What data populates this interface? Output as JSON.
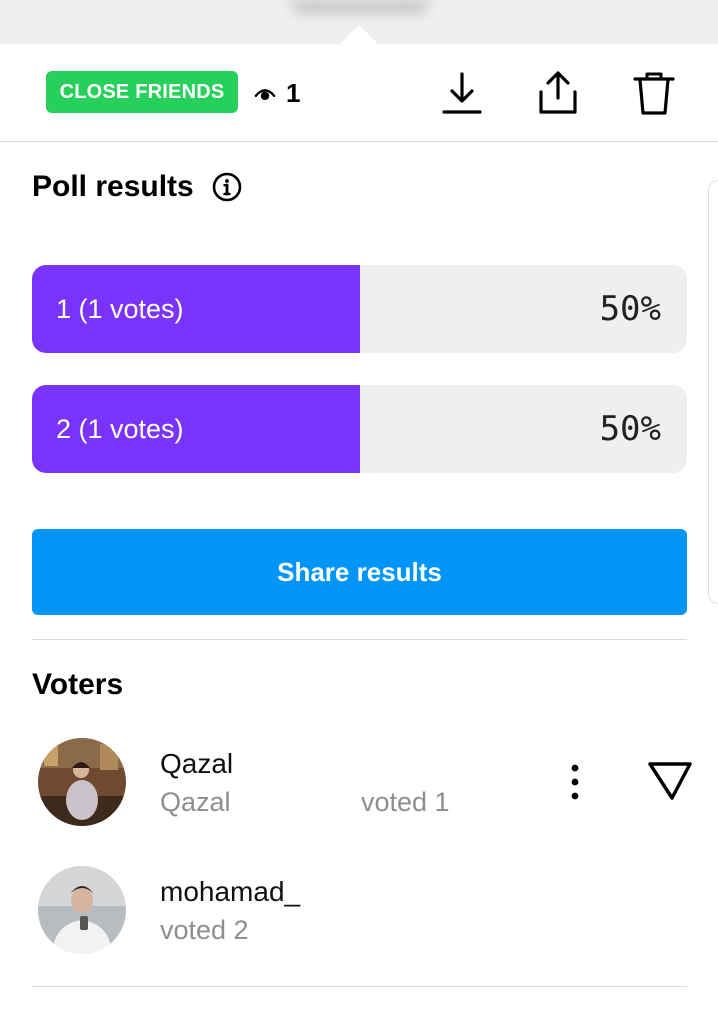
{
  "header": {
    "badge_label": "CLOSE FRIENDS",
    "view_count": "1",
    "icons": [
      "eye-icon",
      "download-icon",
      "share-icon",
      "trash-icon"
    ]
  },
  "poll": {
    "title": "Poll results",
    "options": [
      {
        "label": "1 (1 votes)",
        "percent_text": "50%",
        "fraction": 0.5
      },
      {
        "label": "2 (1 votes)",
        "percent_text": "50%",
        "fraction": 0.5
      }
    ],
    "share_button_label": "Share results"
  },
  "voters": {
    "title": "Voters",
    "list": [
      {
        "name": "Qazal",
        "subtitle": "Qazal",
        "vote_text": "voted 1"
      },
      {
        "name": "mohamad_",
        "subtitle": "voted 2"
      }
    ]
  },
  "colors": {
    "badge": "#26d05a",
    "bar_fill": "#7933fb",
    "bar_track": "#efefef",
    "button": "#0095f6"
  }
}
